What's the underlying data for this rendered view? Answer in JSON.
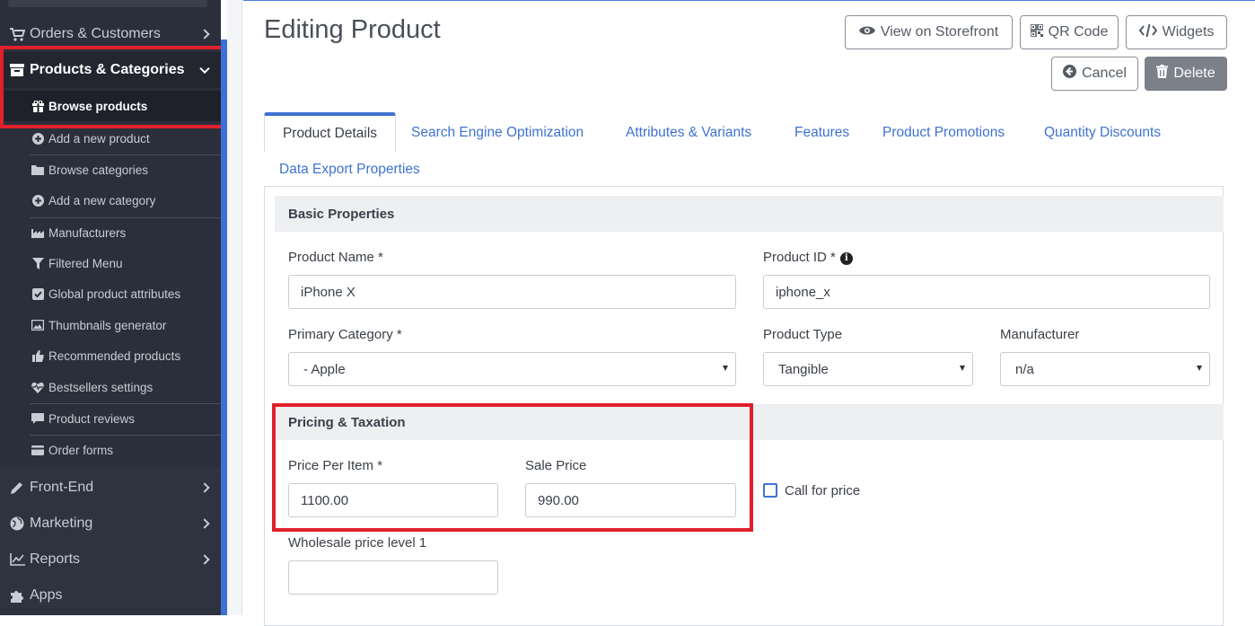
{
  "sidebar": {
    "top_items": [
      {
        "label": "Orders & Customers",
        "icon": "cart-icon"
      },
      {
        "label": "Products & Categories",
        "icon": "archive-box-icon"
      }
    ],
    "sub_items": [
      {
        "label": "Browse products",
        "icon": "gift-icon"
      },
      {
        "label": "Add a new product",
        "icon": "plus-circle-icon"
      },
      {
        "label": "Browse categories",
        "icon": "folder-icon"
      },
      {
        "label": "Add a new category",
        "icon": "plus-circle-icon"
      },
      {
        "label": "Manufacturers",
        "icon": "factory-icon"
      },
      {
        "label": "Filtered Menu",
        "icon": "filter-icon"
      },
      {
        "label": "Global product attributes",
        "icon": "checkbox-icon"
      },
      {
        "label": "Thumbnails generator",
        "icon": "image-icon"
      },
      {
        "label": "Recommended products",
        "icon": "thumbs-up-icon"
      },
      {
        "label": "Bestsellers settings",
        "icon": "heartbeat-icon"
      },
      {
        "label": "Product reviews",
        "icon": "comment-icon"
      },
      {
        "label": "Order forms",
        "icon": "credit-card-icon"
      }
    ],
    "bottom_items": [
      {
        "label": "Front-End",
        "icon": "pencil-icon"
      },
      {
        "label": "Marketing",
        "icon": "globe-icon"
      },
      {
        "label": "Reports",
        "icon": "line-chart-icon"
      },
      {
        "label": "Apps",
        "icon": "puzzle-icon"
      }
    ]
  },
  "header": {
    "title": "Editing Product",
    "buttons": {
      "view_storefront": "View on Storefront",
      "qr_code": "QR Code",
      "widgets": "Widgets",
      "cancel": "Cancel",
      "delete": "Delete"
    }
  },
  "tabs": [
    "Product Details",
    "Search Engine Optimization",
    "Attributes & Variants",
    "Features",
    "Product Promotions",
    "Quantity Discounts",
    "Data Export Properties"
  ],
  "basic": {
    "heading": "Basic Properties",
    "product_name_label": "Product Name *",
    "product_name_value": "iPhone X",
    "product_id_label": "Product ID *",
    "product_id_value": "iphone_x",
    "primary_category_label": "Primary Category *",
    "primary_category_value": "- Apple",
    "product_type_label": "Product Type",
    "product_type_value": "Tangible",
    "manufacturer_label": "Manufacturer",
    "manufacturer_value": "n/a"
  },
  "pricing": {
    "heading": "Pricing & Taxation",
    "price_label": "Price Per Item *",
    "price_value": "1100.00",
    "sale_label": "Sale Price",
    "sale_value": "990.00",
    "call_for_price_label": "Call for price",
    "wholesale_label": "Wholesale price level 1",
    "wholesale_value": ""
  },
  "colors": {
    "sidebar_bg": "#2b2f3b",
    "accent_blue": "#3f72d1",
    "highlight_red": "#e0202a"
  }
}
